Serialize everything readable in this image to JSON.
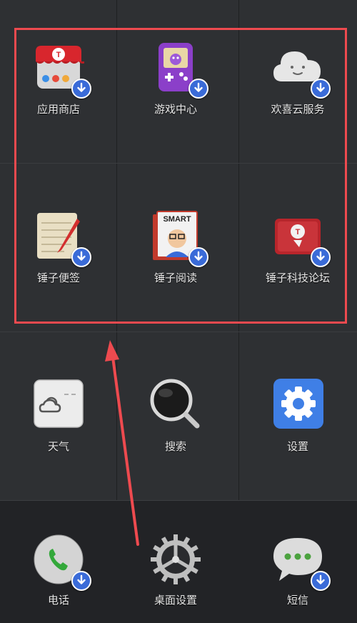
{
  "apps": [
    {
      "label": "应用商店",
      "icon": "app-store-icon",
      "downloading": true
    },
    {
      "label": "游戏中心",
      "icon": "game-center-icon",
      "downloading": true
    },
    {
      "label": "欢喜云服务",
      "icon": "cloud-service-icon",
      "downloading": true
    },
    {
      "label": "锤子便签",
      "icon": "notes-icon",
      "downloading": true
    },
    {
      "label": "锤子阅读",
      "icon": "smart-reader-icon",
      "downloading": true,
      "badge_text": "SMART"
    },
    {
      "label": "锤子科技论坛",
      "icon": "forum-icon",
      "downloading": true
    },
    {
      "label": "天气",
      "icon": "weather-icon",
      "downloading": false
    },
    {
      "label": "搜索",
      "icon": "search-icon",
      "downloading": false
    },
    {
      "label": "设置",
      "icon": "settings-gear-icon",
      "downloading": false
    }
  ],
  "dock": [
    {
      "label": "电话",
      "icon": "phone-icon",
      "downloading": true
    },
    {
      "label": "桌面设置",
      "icon": "desktop-settings-icon",
      "downloading": false
    },
    {
      "label": "短信",
      "icon": "messages-icon",
      "downloading": true
    }
  ],
  "colors": {
    "highlight": "#ee4a4f",
    "download_badge": "#3a6bd8",
    "background": "#2e3033",
    "dock_background": "#222326",
    "settings_blue": "#3f7fe6"
  }
}
